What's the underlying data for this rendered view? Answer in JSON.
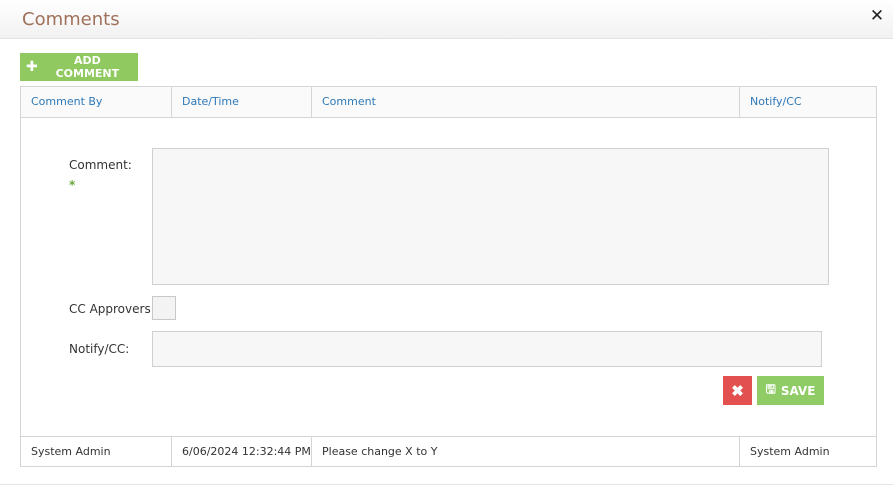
{
  "dialog": {
    "title": "Comments",
    "close_icon": "close-icon",
    "close_glyph": "✕"
  },
  "toolbar": {
    "add_label": "ADD COMMENT",
    "add_icon": "plus-icon",
    "add_glyph": "✚"
  },
  "table": {
    "columns": [
      "Comment By",
      "Date/Time",
      "Comment",
      "Notify/CC"
    ],
    "rows": [
      {
        "comment_by": "System Admin",
        "date_time": "6/06/2024 12:32:44 PM",
        "comment": "Please change X to Y",
        "notify_cc": "System Admin"
      }
    ]
  },
  "form": {
    "comment_label": "Comment:",
    "required_marker": "*",
    "comment_value": "",
    "cc_approvers_label": "CC Approvers:",
    "cc_approvers_checked": false,
    "notify_label": "Notify/CC:",
    "notify_value": "",
    "cancel_icon": "close-icon",
    "cancel_glyph": "✖",
    "save_label": "SAVE",
    "save_icon": "floppy-disk-icon",
    "save_glyph": "🖫"
  },
  "colors": {
    "title": "#a0715a",
    "header_link": "#2e78b7",
    "add_button": "#8fc95f",
    "save_button": "#90cc66",
    "cancel_button": "#e25050",
    "required": "#69a83c"
  }
}
